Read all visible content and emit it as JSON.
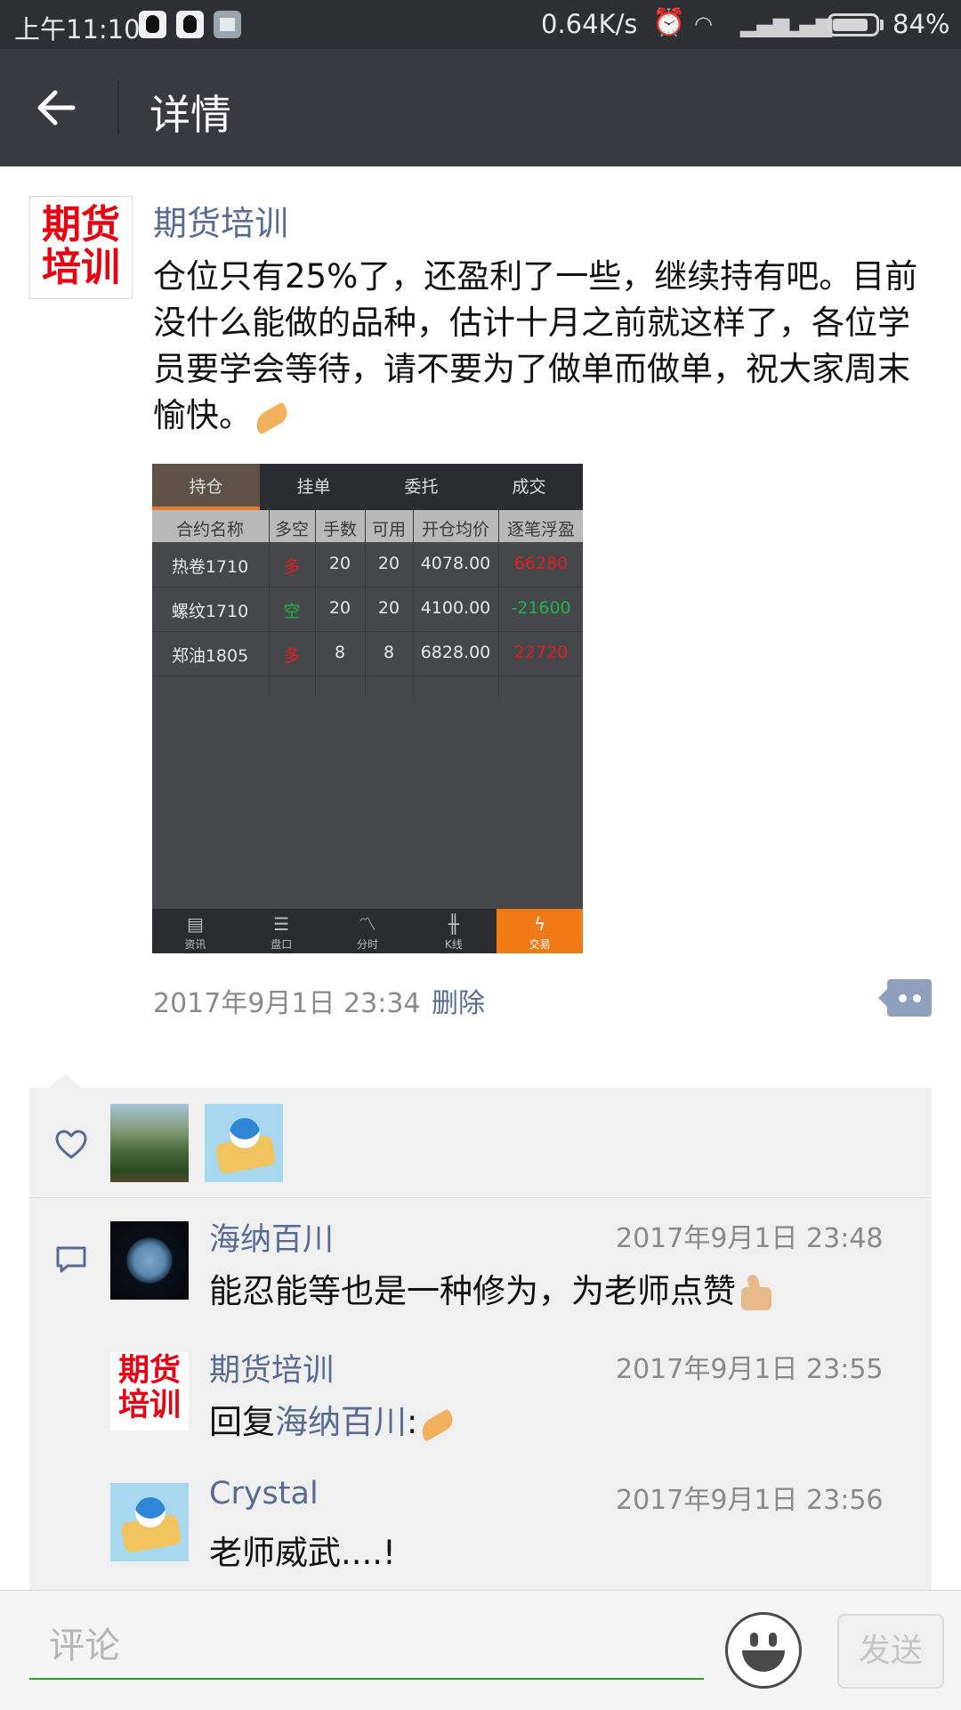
{
  "status_bar": {
    "time": "上午11:10",
    "network_speed": "0.64K/s",
    "battery": "84%",
    "battery_level": 0.84
  },
  "header": {
    "title": "详情"
  },
  "post": {
    "author": "期货培训",
    "avatar_text_1": "期货",
    "avatar_text_2": "培训",
    "text": "仓位只有25%了，还盈利了一些，继续持有吧。目前没什么能做的品种，估计十月之前就这样了，各位学员要学会等待，请不要为了做单而做单，祝大家周末愉快。",
    "timestamp": "2017年9月1日 23:34",
    "delete_label": "删除"
  },
  "screenshot": {
    "tabs": [
      "持仓",
      "挂单",
      "委托",
      "成交"
    ],
    "columns": [
      "合约名称",
      "多空",
      "手数",
      "可用",
      "开仓均价",
      "逐笔浮盈"
    ],
    "rows": [
      {
        "name": "热卷1710",
        "side": "多",
        "lots": "20",
        "avail": "20",
        "price": "4078.00",
        "pnl": "66280"
      },
      {
        "name": "螺纹1710",
        "side": "空",
        "lots": "20",
        "avail": "20",
        "price": "4100.00",
        "pnl": "-21600"
      },
      {
        "name": "郑油1805",
        "side": "多",
        "lots": "8",
        "avail": "8",
        "price": "6828.00",
        "pnl": "22720"
      }
    ],
    "bottom_nav": [
      "资讯",
      "盘口",
      "分时",
      "K线",
      "交易"
    ]
  },
  "comments": [
    {
      "name": "海纳百川",
      "time": "2017年9月1日 23:48",
      "text": "能忍能等也是一种修为，为老师点赞"
    },
    {
      "name": "期货培训",
      "time": "2017年9月1日 23:55",
      "reply_prefix": "回复",
      "reply_to": "海纳百川",
      "colon": ":"
    },
    {
      "name": "Crystal",
      "time": "2017年9月1日 23:56",
      "text": "老师威武....!"
    }
  ],
  "input": {
    "placeholder": "评论",
    "send_label": "发送"
  },
  "colors": {
    "link": "#576b95",
    "header": "#393a3f",
    "accent": "#1aad19"
  }
}
